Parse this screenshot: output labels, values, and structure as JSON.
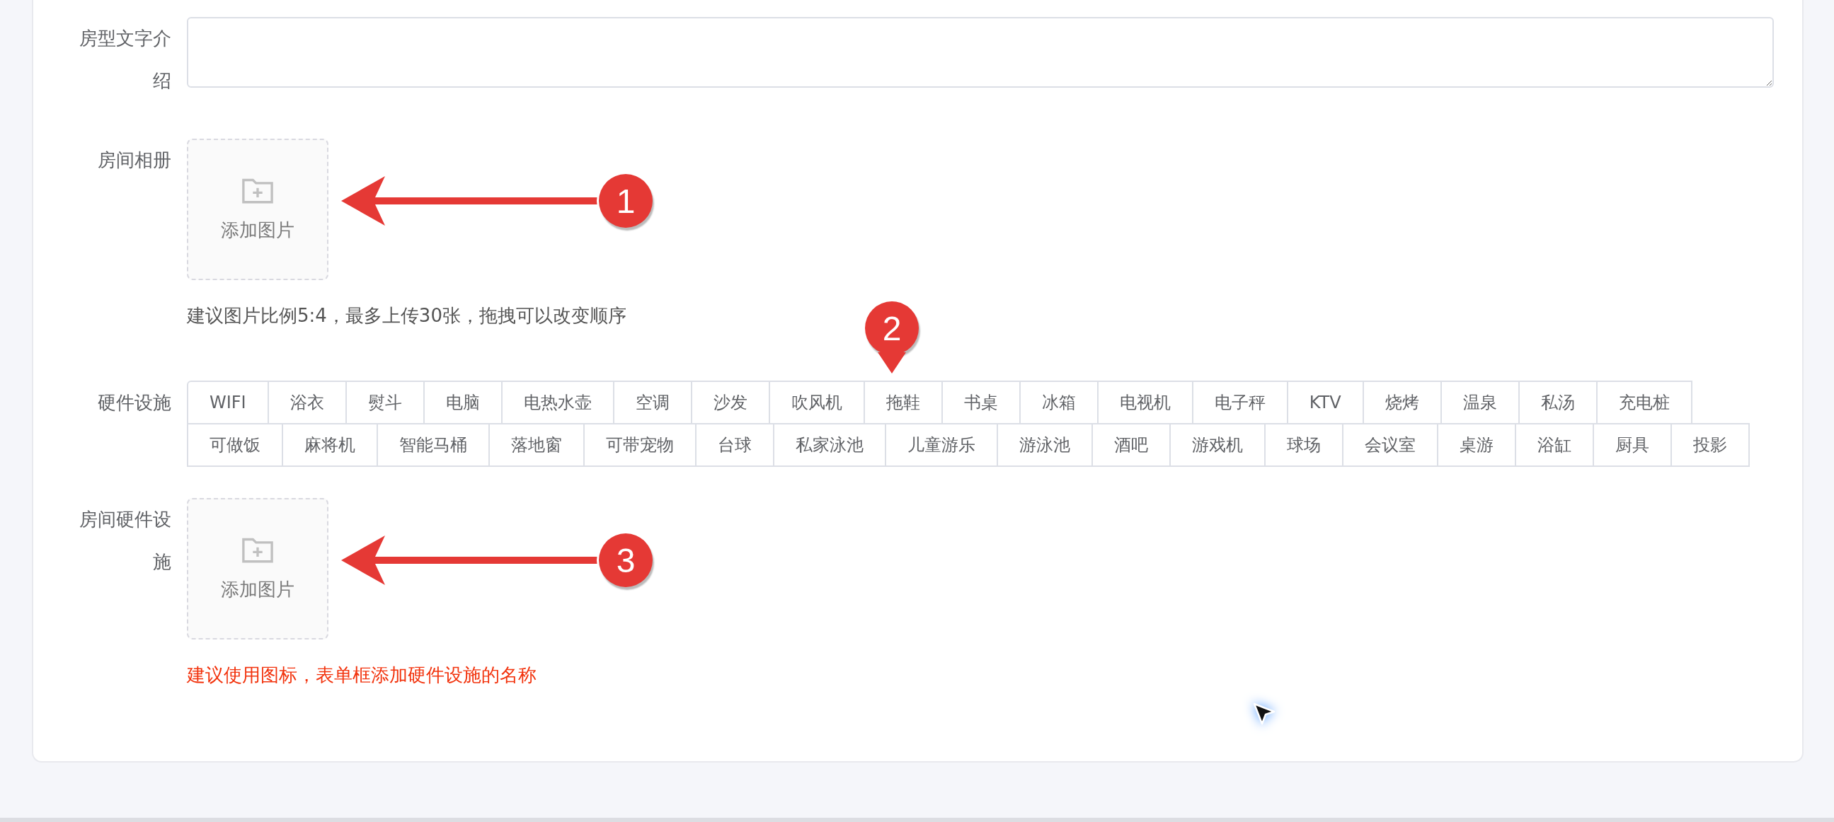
{
  "fields": [
    {
      "kind": "textarea",
      "label": "房型文字介绍"
    },
    {
      "kind": "upload",
      "label": "房间相册",
      "button": "添加图片",
      "hint": "建议图片比例5:4，最多上传30张，拖拽可以改变顺序",
      "hint_warning": false,
      "annotation": "1"
    },
    {
      "kind": "tags",
      "label": "硬件设施",
      "annotation": "2",
      "tag_lines": [
        {
          "tags": [
            "WIFI",
            "浴衣",
            "熨斗",
            "电脑",
            "电热水壶",
            "空调",
            "沙发",
            "吹风机",
            "拖鞋",
            "书桌",
            "冰箱",
            "电视机",
            "电子秤",
            "KTV",
            "烧烤",
            "温泉",
            "私汤",
            "充电桩"
          ]
        },
        {
          "tags": [
            "可做饭",
            "麻将机",
            "智能马桶",
            "落地窗",
            "可带宠物",
            "台球",
            "私家泳池",
            "儿童游乐",
            "游泳池",
            "酒吧",
            "游戏机",
            "球场",
            "会议室",
            "桌游",
            "浴缸",
            "厨具",
            "投影"
          ]
        }
      ]
    },
    {
      "kind": "upload",
      "label": "房间硬件设施",
      "button": "添加图片",
      "hint": "建议使用图标，表单框添加硬件设施的名称",
      "hint_warning": true,
      "annotation": "3"
    }
  ]
}
